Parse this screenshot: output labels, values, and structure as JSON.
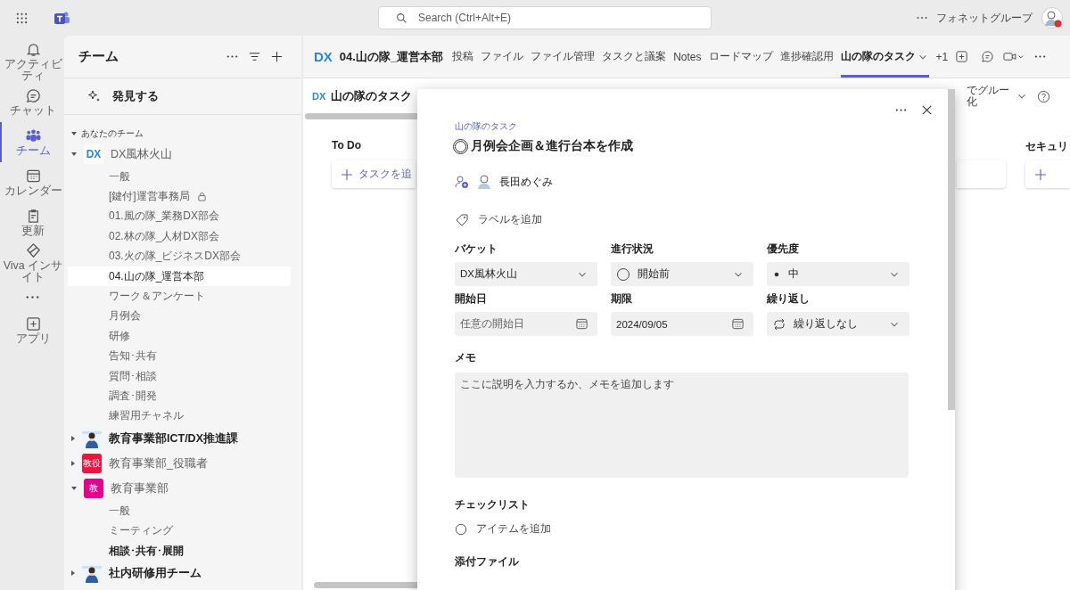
{
  "app_bar": {
    "search_placeholder": "Search (Ctrl+Alt+E)",
    "org_name": "フォネットグループ"
  },
  "rail": [
    {
      "kind": "bell",
      "label": "アクティビティ",
      "selected": false
    },
    {
      "kind": "chat",
      "label": "チャット",
      "selected": false
    },
    {
      "kind": "people",
      "label": "チーム",
      "selected": true
    },
    {
      "kind": "calendar",
      "label": "カレンダー",
      "selected": false
    },
    {
      "kind": "clipboard",
      "label": "更新",
      "selected": false
    },
    {
      "kind": "viva",
      "label": "Viva インサイト",
      "selected": false
    },
    {
      "kind": "more"
    },
    {
      "kind": "apps",
      "label": "アプリ",
      "selected": false
    }
  ],
  "sidebar": {
    "title": "チーム",
    "discover": "発見する",
    "section": "あなたのチーム",
    "section_expanded": true,
    "teams": [
      {
        "name": "DX風林火山",
        "avatar": {
          "kind": "logo",
          "text": "DX"
        },
        "expanded": true,
        "unread": false,
        "children": [
          {
            "name": "一般",
            "selected": false,
            "unread": false,
            "locked": false
          },
          {
            "name": "[鍵付]運営事務局",
            "selected": false,
            "unread": false,
            "locked": true
          },
          {
            "name": "01.風の隊_業務DX部会",
            "selected": false,
            "unread": false,
            "locked": false
          },
          {
            "name": "02.林の隊_人材DX部会",
            "selected": false,
            "unread": false,
            "locked": false
          },
          {
            "name": "03.火の隊_ビジネスDX部会",
            "selected": false,
            "unread": false,
            "locked": false
          },
          {
            "name": "04.山の隊_運営本部",
            "selected": true,
            "unread": false,
            "locked": false
          },
          {
            "name": "ワーク＆アンケート",
            "selected": false,
            "unread": false,
            "locked": false
          },
          {
            "name": "月例会",
            "selected": false,
            "unread": false,
            "locked": false
          },
          {
            "name": "研修",
            "selected": false,
            "unread": false,
            "locked": false
          },
          {
            "name": "告知･共有",
            "selected": false,
            "unread": false,
            "locked": false
          },
          {
            "name": "質問･相談",
            "selected": false,
            "unread": false,
            "locked": false
          },
          {
            "name": "調査･開発",
            "selected": false,
            "unread": false,
            "locked": false
          },
          {
            "name": "練習用チャネル",
            "selected": false,
            "unread": false,
            "locked": false
          }
        ]
      },
      {
        "name": "教育事業部ICT/DX推進課",
        "expanded": false,
        "unread": true
      },
      {
        "name": "教育事業部_役職者",
        "avatar": {
          "kind": "text",
          "text": "教役",
          "color": "#e8173f"
        },
        "expanded": false,
        "unread": false
      },
      {
        "name": "教育事業部",
        "avatar": {
          "kind": "text",
          "text": "教",
          "color": "#e3008c"
        },
        "expanded": true,
        "unread": false,
        "children": [
          {
            "name": "一般",
            "selected": false,
            "unread": false,
            "locked": false
          },
          {
            "name": "ミーティング",
            "selected": false,
            "unread": false,
            "locked": false
          },
          {
            "name": "相談･共有･展開",
            "selected": false,
            "unread": true,
            "locked": false
          }
        ]
      },
      {
        "name": "社内研修用チーム",
        "expanded": false,
        "unread": true
      }
    ]
  },
  "channel_header": {
    "logo": "DX",
    "title": "04.山の隊_運営本部",
    "tabs": [
      {
        "label": "投稿",
        "selected": false
      },
      {
        "label": "ファイル",
        "selected": false
      },
      {
        "label": "ファイル管理",
        "selected": false
      },
      {
        "label": "タスクと議案",
        "selected": false
      },
      {
        "label": "Notes",
        "selected": false
      },
      {
        "label": "ロードマップ",
        "selected": false
      },
      {
        "label": "進捗確認用",
        "selected": false
      },
      {
        "label": "山の隊のタスク",
        "selected": true
      }
    ],
    "more_tabs": "+1"
  },
  "planner": {
    "logo": "DX",
    "title": "山の隊のタスク",
    "group_by": "でグルー化",
    "columns": [
      {
        "title": "To Do",
        "add_label": "タスクを追"
      },
      {
        "title": "セキュリ"
      }
    ]
  },
  "task": {
    "plan": "山の隊のタスク",
    "title": "月例会企画＆進行台本を作成",
    "completed": false,
    "assignee": "長田めぐみ",
    "label_prompt": "ラベルを追加",
    "fields": [
      {
        "label": "バケット",
        "kind": "dropdown",
        "value": "DX風林火山"
      },
      {
        "label": "進行状況",
        "kind": "status",
        "value": "開始前"
      },
      {
        "label": "優先度",
        "kind": "priority",
        "value": "中"
      },
      {
        "label": "開始日",
        "kind": "date",
        "placeholder": "任意の開始日"
      },
      {
        "label": "期限",
        "kind": "date",
        "value": "2024/09/05"
      },
      {
        "label": "繰り返し",
        "kind": "recurrence",
        "value": "繰り返しなし"
      }
    ],
    "notes": {
      "label": "メモ",
      "placeholder": "ここに説明を入力するか、メモを追加します"
    },
    "checklist": {
      "label": "チェックリスト",
      "add_item": "アイテムを追加"
    },
    "attachments": {
      "label": "添付ファイル"
    }
  }
}
